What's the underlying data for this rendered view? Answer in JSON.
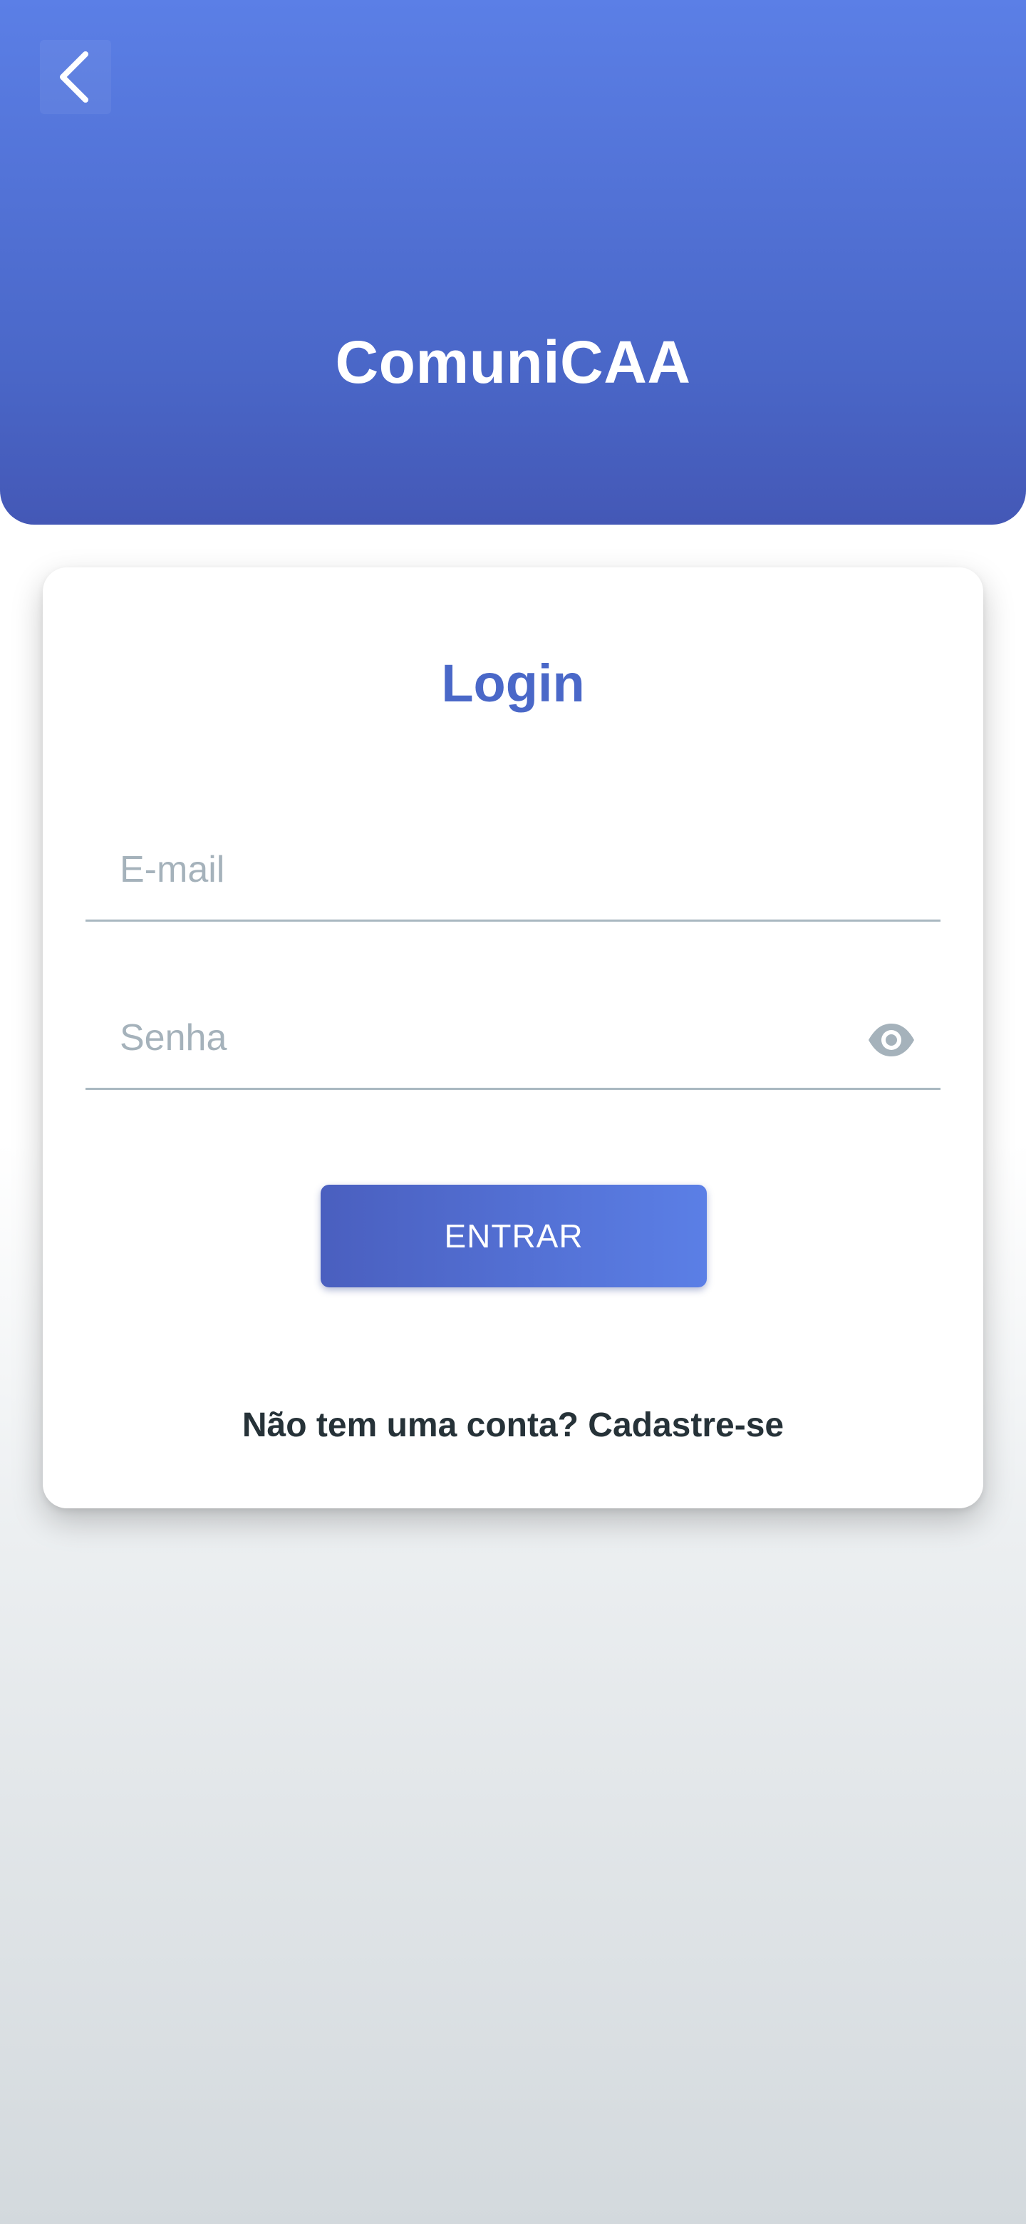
{
  "header": {
    "back_icon": "chevron-left-icon",
    "title": "ComuniCAA"
  },
  "login": {
    "title": "Login",
    "email": {
      "placeholder": "E-mail",
      "value": ""
    },
    "password": {
      "placeholder": "Senha",
      "value": "",
      "toggle_icon": "eye-icon"
    },
    "submit_label": "ENTRAR",
    "signup_text": "Não tem uma conta? Cadastre-se"
  },
  "colors": {
    "header_gradient_top": "#5b7fe6",
    "header_gradient_bottom": "#4458b6",
    "accent": "#4a68c8",
    "button_gradient_start": "#4a5fbf",
    "button_gradient_end": "#5b7fe6",
    "placeholder": "#a5b2bb",
    "text_dark": "#263238"
  }
}
